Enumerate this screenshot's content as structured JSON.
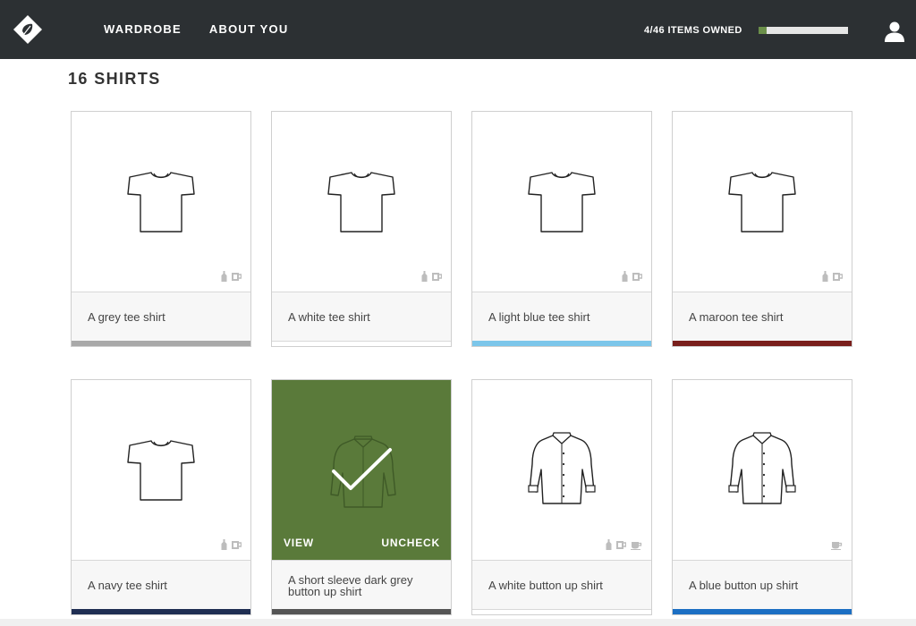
{
  "topbar": {
    "nav": [
      {
        "label": "WARDROBE"
      },
      {
        "label": "ABOUT YOU"
      }
    ],
    "owned_text": "4/46 ITEMS OWNED",
    "owned_fraction": 0.087
  },
  "page": {
    "heading": "16 SHIRTS"
  },
  "cards": [
    {
      "caption": "A grey tee shirt",
      "color": "#a9a9a9",
      "garment": "tee",
      "tags": [
        "bottle-icon",
        "mug-icon"
      ]
    },
    {
      "caption": "A white tee shirt",
      "color": "#ffffff",
      "garment": "tee",
      "tags": [
        "bottle-icon",
        "mug-icon"
      ]
    },
    {
      "caption": "A light blue tee shirt",
      "color": "#7cc6ea",
      "garment": "tee",
      "tags": [
        "bottle-icon",
        "mug-icon"
      ]
    },
    {
      "caption": "A maroon tee shirt",
      "color": "#7a1f1c",
      "garment": "tee",
      "tags": [
        "bottle-icon",
        "mug-icon"
      ]
    },
    {
      "caption": "A navy tee shirt",
      "color": "#1f2e52",
      "garment": "tee",
      "tags": [
        "bottle-icon",
        "mug-icon"
      ]
    },
    {
      "caption": "A short sleeve dark grey button up shirt",
      "color": "#555555",
      "garment": "shirt",
      "selected": true,
      "view_label": "VIEW",
      "uncheck_label": "UNCHECK"
    },
    {
      "caption": "A white button up shirt",
      "color": "#ffffff",
      "garment": "shirt",
      "tags": [
        "bottle-icon",
        "mug-icon",
        "cup-icon"
      ]
    },
    {
      "caption": "A blue button up shirt",
      "color": "#1c6fc3",
      "garment": "shirt",
      "tags": [
        "cup-icon"
      ]
    }
  ]
}
